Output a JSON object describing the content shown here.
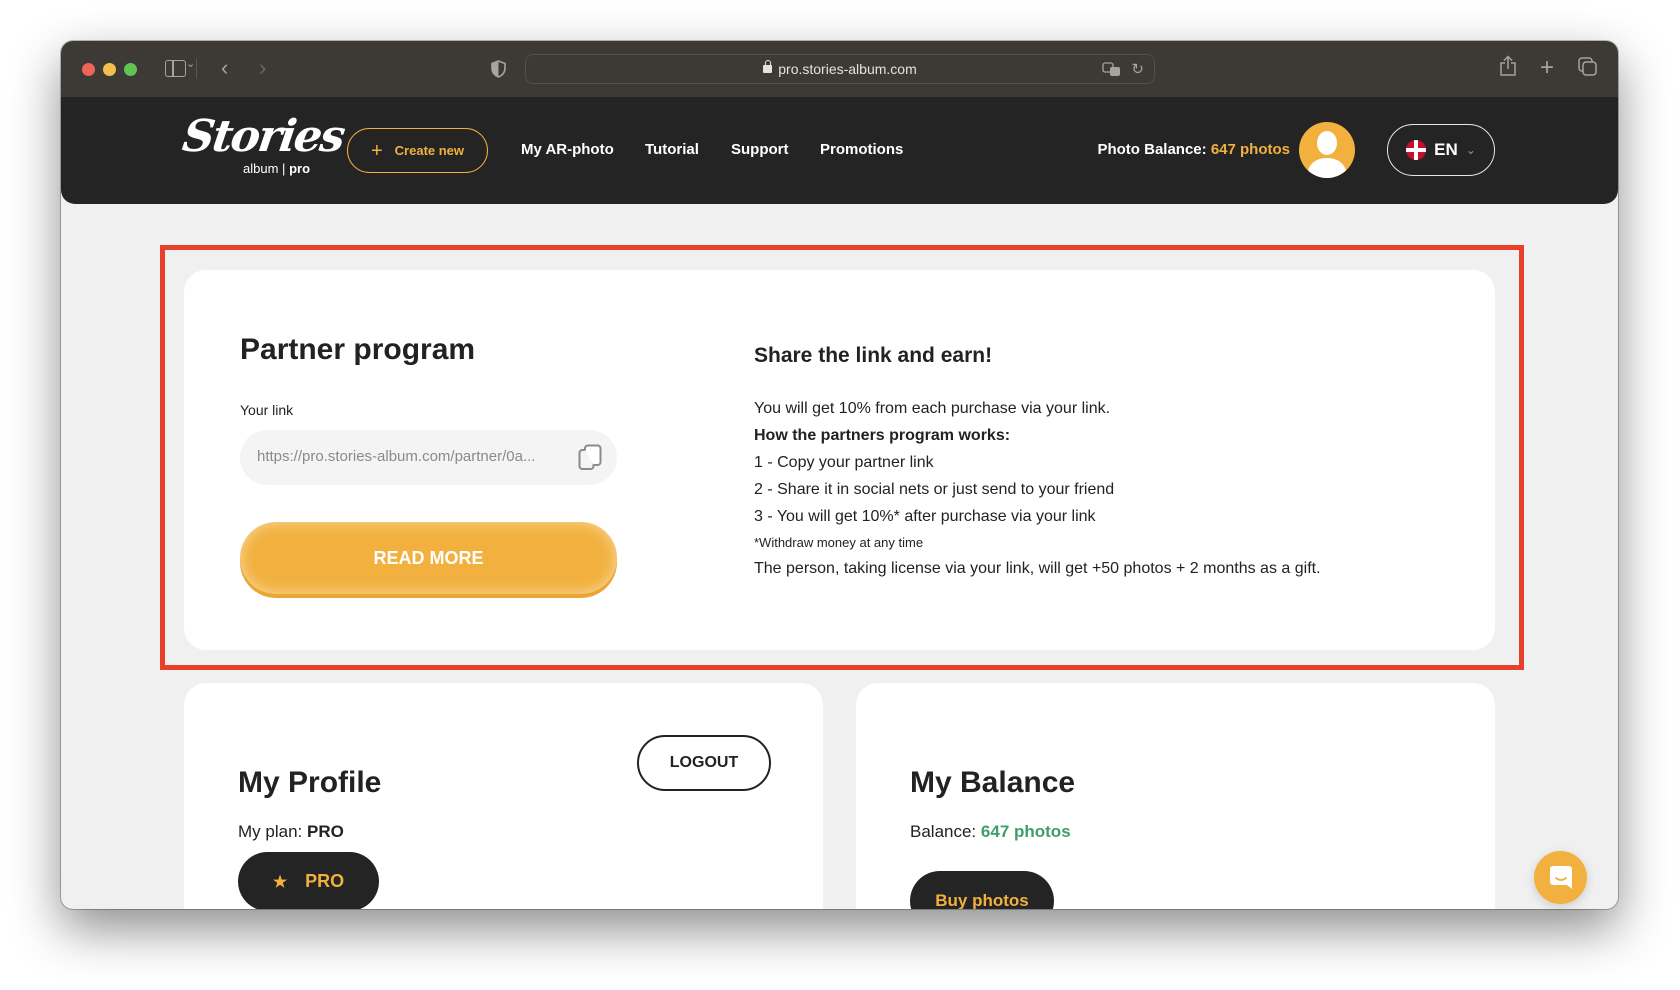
{
  "browser": {
    "url": "pro.stories-album.com",
    "icons": [
      "close-dot",
      "minimize-dot",
      "zoom-dot",
      "sidebar-icon",
      "chevron-down-icon",
      "back-icon",
      "forward-icon",
      "shield-icon",
      "lock-icon",
      "translate-icon",
      "reload-icon",
      "share-icon",
      "new-tab-icon",
      "tabs-overview-icon"
    ]
  },
  "header": {
    "logo_main": "Stories",
    "logo_sub_light": "album",
    "logo_sub_bold": "pro",
    "create_new": "Create new",
    "nav": [
      "My AR-photo",
      "Tutorial",
      "Support",
      "Promotions"
    ],
    "balance_label": "Photo Balance:",
    "balance_value": "647 photos",
    "language": "EN"
  },
  "partner": {
    "title": "Partner program",
    "link_label": "Your link",
    "link_value": "https://pro.stories-album.com/partner/0a...",
    "read_more": "READ MORE",
    "share_title": "Share the link and earn!",
    "lines": [
      "You will get 10% from each purchase via your link.",
      "How the partners program works:",
      "1 - Copy your partner link",
      "2 - Share it in social nets or just send to your friend",
      "3 - You will get 10%* after purchase via your link",
      "*Withdraw money at any time",
      "The person, taking license via your link, will get +50 photos + 2 months as a gift."
    ]
  },
  "profile": {
    "title": "My Profile",
    "logout": "LOGOUT",
    "plan_label": "My plan:",
    "plan_value": "PRO",
    "plan_button": "PRO"
  },
  "balance": {
    "title": "My Balance",
    "label": "Balance:",
    "value": "647 photos",
    "buy": "Buy photos"
  },
  "colors": {
    "accent": "#f2b13e",
    "header_bg": "#242424",
    "highlight": "#e8412b",
    "balance_green": "#3f9e69"
  }
}
